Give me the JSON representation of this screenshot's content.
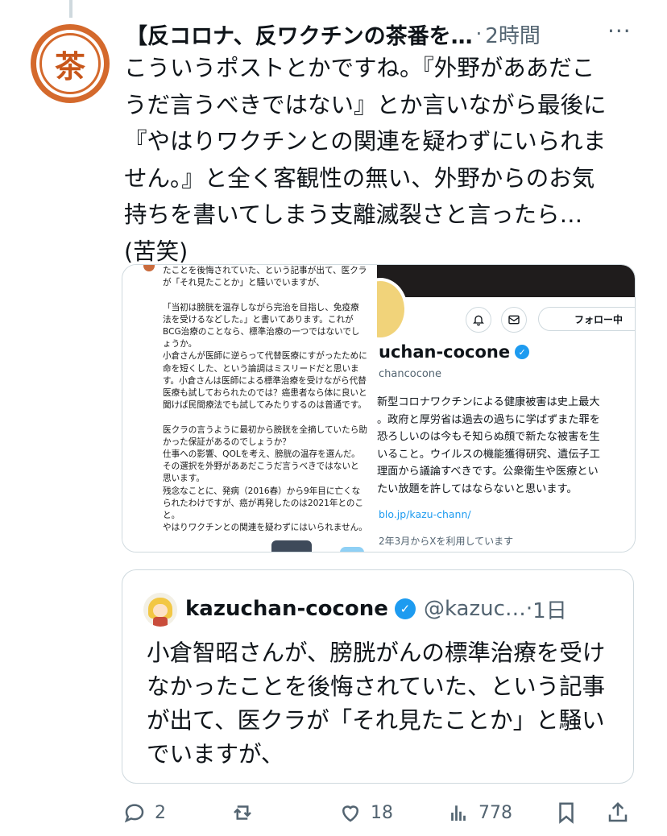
{
  "post": {
    "avatar_glyph": "茶",
    "author_name": "【反コロナ、反ワクチンの茶番を…",
    "separator": "·",
    "timestamp": "2時間",
    "more_glyph": "···",
    "text": "こういうポストとかですね。『外野がああだこうだ言うべきではない』とか言いながら最後に『やはりワクチンとの関連を疑わずにいられません。』と全く客観性の無い、外野からのお気持ちを書いてしまう支離滅裂さと言ったら… (苦笑)"
  },
  "media": {
    "article_text": "たことを後悔されていた、という記事が出て、医クラが「それ見たことか」と騒いでいますが、\n\n「当初は膀胱を温存しながら完治を目指し、免疫療法を受けるなどした。」と書いてあります。これがBCG治療のことなら、標準治療の一つではないでしょうか。\n小倉さんが医師に逆らって代替医療にすがったために命を短くした、という論調はミスリードだと思います。小倉さんは医師による標準治療を受けながら代替医療も試しておられたのでは？癌患者なら体に良いと聞けば民間療法でも試してみたりするのは普通です。\n\n医クラの言うように最初から膀胱を全摘していたら助かった保証があるのでしょうか？\n仕事への影響、QOLを考え、膀胱の温存を選んだ。その選択を外野がああだこうだ言うべきではないと思います。\n残念なことに、発病（2016春）から9年目に亡くなられたわけですが、癌が再発したのは2021年とのこと。\nやはりワクチンとの関連を疑わずにはいられません。",
    "profile": {
      "follow_label": "フォロー中",
      "name": "uchan-cocone",
      "handle": "chancocone",
      "bio": "新型コロナワクチンによる健康被害は史上最大\n。政府と厚労省は過去の過ちに学ばずまた罪を\n恐ろしいのは今もそ知らぬ顔で新たな被害を生\nいること。ウイルスの機能獲得研究、遺伝子工\n理面から議論すべきです。公衆衛生や医療とい\nたい放題を許してはならないと思います。",
      "link": "blo.jp/kazu-chann/",
      "joined": "2年3月からXを利用しています"
    }
  },
  "quote": {
    "author_name": "kazuchan-cocone",
    "handle": "@kazuc…",
    "separator": "·",
    "timestamp": "1日",
    "text": "小倉智昭さんが、膀胱がんの標準治療を受けなかったことを後悔されていた、という記事が出て、医クラが「それ見たことか」と騒いでいますが、"
  },
  "actions": {
    "replies": "2",
    "reposts": "",
    "likes": "18",
    "views": "778"
  },
  "colors": {
    "accent": "#1d9bf0",
    "avatar_ring": "#d4692c",
    "secondary_text": "#536471",
    "border": "#cfd9de"
  }
}
